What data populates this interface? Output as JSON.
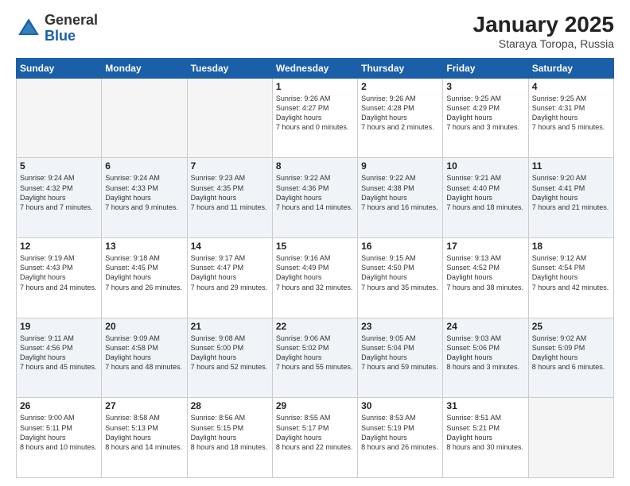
{
  "header": {
    "logo_general": "General",
    "logo_blue": "Blue",
    "month_year": "January 2025",
    "location": "Staraya Toropa, Russia"
  },
  "days_of_week": [
    "Sunday",
    "Monday",
    "Tuesday",
    "Wednesday",
    "Thursday",
    "Friday",
    "Saturday"
  ],
  "weeks": [
    [
      {
        "num": "",
        "empty": true
      },
      {
        "num": "",
        "empty": true
      },
      {
        "num": "",
        "empty": true
      },
      {
        "num": "1",
        "sunrise": "9:26 AM",
        "sunset": "4:27 PM",
        "daylight": "7 hours and 0 minutes."
      },
      {
        "num": "2",
        "sunrise": "9:26 AM",
        "sunset": "4:28 PM",
        "daylight": "7 hours and 2 minutes."
      },
      {
        "num": "3",
        "sunrise": "9:25 AM",
        "sunset": "4:29 PM",
        "daylight": "7 hours and 3 minutes."
      },
      {
        "num": "4",
        "sunrise": "9:25 AM",
        "sunset": "4:31 PM",
        "daylight": "7 hours and 5 minutes."
      }
    ],
    [
      {
        "num": "5",
        "sunrise": "9:24 AM",
        "sunset": "4:32 PM",
        "daylight": "7 hours and 7 minutes."
      },
      {
        "num": "6",
        "sunrise": "9:24 AM",
        "sunset": "4:33 PM",
        "daylight": "7 hours and 9 minutes."
      },
      {
        "num": "7",
        "sunrise": "9:23 AM",
        "sunset": "4:35 PM",
        "daylight": "7 hours and 11 minutes."
      },
      {
        "num": "8",
        "sunrise": "9:22 AM",
        "sunset": "4:36 PM",
        "daylight": "7 hours and 14 minutes."
      },
      {
        "num": "9",
        "sunrise": "9:22 AM",
        "sunset": "4:38 PM",
        "daylight": "7 hours and 16 minutes."
      },
      {
        "num": "10",
        "sunrise": "9:21 AM",
        "sunset": "4:40 PM",
        "daylight": "7 hours and 18 minutes."
      },
      {
        "num": "11",
        "sunrise": "9:20 AM",
        "sunset": "4:41 PM",
        "daylight": "7 hours and 21 minutes."
      }
    ],
    [
      {
        "num": "12",
        "sunrise": "9:19 AM",
        "sunset": "4:43 PM",
        "daylight": "7 hours and 24 minutes."
      },
      {
        "num": "13",
        "sunrise": "9:18 AM",
        "sunset": "4:45 PM",
        "daylight": "7 hours and 26 minutes."
      },
      {
        "num": "14",
        "sunrise": "9:17 AM",
        "sunset": "4:47 PM",
        "daylight": "7 hours and 29 minutes."
      },
      {
        "num": "15",
        "sunrise": "9:16 AM",
        "sunset": "4:49 PM",
        "daylight": "7 hours and 32 minutes."
      },
      {
        "num": "16",
        "sunrise": "9:15 AM",
        "sunset": "4:50 PM",
        "daylight": "7 hours and 35 minutes."
      },
      {
        "num": "17",
        "sunrise": "9:13 AM",
        "sunset": "4:52 PM",
        "daylight": "7 hours and 38 minutes."
      },
      {
        "num": "18",
        "sunrise": "9:12 AM",
        "sunset": "4:54 PM",
        "daylight": "7 hours and 42 minutes."
      }
    ],
    [
      {
        "num": "19",
        "sunrise": "9:11 AM",
        "sunset": "4:56 PM",
        "daylight": "7 hours and 45 minutes."
      },
      {
        "num": "20",
        "sunrise": "9:09 AM",
        "sunset": "4:58 PM",
        "daylight": "7 hours and 48 minutes."
      },
      {
        "num": "21",
        "sunrise": "9:08 AM",
        "sunset": "5:00 PM",
        "daylight": "7 hours and 52 minutes."
      },
      {
        "num": "22",
        "sunrise": "9:06 AM",
        "sunset": "5:02 PM",
        "daylight": "7 hours and 55 minutes."
      },
      {
        "num": "23",
        "sunrise": "9:05 AM",
        "sunset": "5:04 PM",
        "daylight": "7 hours and 59 minutes."
      },
      {
        "num": "24",
        "sunrise": "9:03 AM",
        "sunset": "5:06 PM",
        "daylight": "8 hours and 3 minutes."
      },
      {
        "num": "25",
        "sunrise": "9:02 AM",
        "sunset": "5:09 PM",
        "daylight": "8 hours and 6 minutes."
      }
    ],
    [
      {
        "num": "26",
        "sunrise": "9:00 AM",
        "sunset": "5:11 PM",
        "daylight": "8 hours and 10 minutes."
      },
      {
        "num": "27",
        "sunrise": "8:58 AM",
        "sunset": "5:13 PM",
        "daylight": "8 hours and 14 minutes."
      },
      {
        "num": "28",
        "sunrise": "8:56 AM",
        "sunset": "5:15 PM",
        "daylight": "8 hours and 18 minutes."
      },
      {
        "num": "29",
        "sunrise": "8:55 AM",
        "sunset": "5:17 PM",
        "daylight": "8 hours and 22 minutes."
      },
      {
        "num": "30",
        "sunrise": "8:53 AM",
        "sunset": "5:19 PM",
        "daylight": "8 hours and 26 minutes."
      },
      {
        "num": "31",
        "sunrise": "8:51 AM",
        "sunset": "5:21 PM",
        "daylight": "8 hours and 30 minutes."
      },
      {
        "num": "",
        "empty": true
      }
    ]
  ]
}
